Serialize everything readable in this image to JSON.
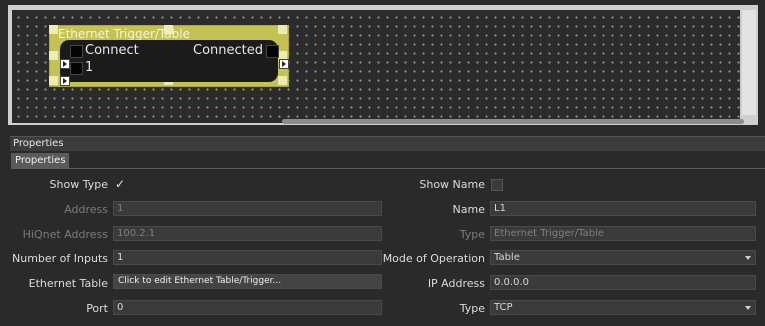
{
  "node": {
    "title": "Ethernet Trigger/Table",
    "input_label": "Connect",
    "input_index": "1",
    "output_label": "Connected"
  },
  "panel": {
    "header": "Properties",
    "tab": "Properties"
  },
  "fields": {
    "show_type": {
      "label": "Show Type",
      "checked": true,
      "check_glyph": "✓"
    },
    "address": {
      "label": "Address",
      "value": "1"
    },
    "hiqnet_address": {
      "label": "HiQnet Address",
      "value": "100.2.1"
    },
    "number_of_inputs": {
      "label": "Number of Inputs",
      "value": "1"
    },
    "ethernet_table": {
      "label": "Ethernet Table",
      "value": "Click to edit Ethernet Table/Trigger..."
    },
    "port": {
      "label": "Port",
      "value": "0"
    },
    "show_name": {
      "label": "Show Name",
      "checked": false
    },
    "name": {
      "label": "Name",
      "value": "L1"
    },
    "type_display": {
      "label": "Type",
      "value": "Ethernet Trigger/Table"
    },
    "mode_of_operation": {
      "label": "Mode of Operation",
      "value": "Table"
    },
    "ip_address": {
      "label": "IP Address",
      "value": "0.0.0.0"
    },
    "protocol_type": {
      "label": "Type",
      "value": "TCP"
    }
  }
}
